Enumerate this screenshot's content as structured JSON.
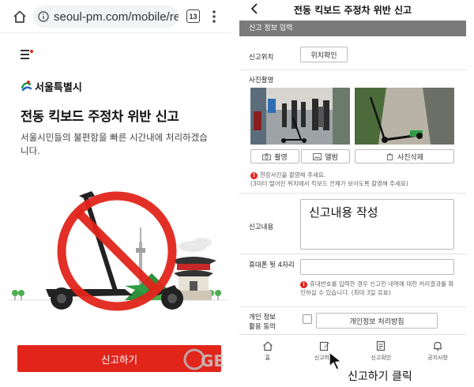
{
  "left": {
    "url": "seoul-pm.com/mobile/report",
    "tab_count": "13",
    "logo_text": "서울특별시",
    "title": "전동 킥보드 주정차 위반 신고",
    "description": "서울시민들의 불편함을 빠른 시간내에 처리하겠습니다.",
    "report_button": "신고하기",
    "watermark": "GE",
    "colors": {
      "accent": "#e1251b"
    }
  },
  "right": {
    "header_title": "전동 킥보드 주정차 위반 신고",
    "section_title": "신고 정보 입력",
    "location_label": "신고위치",
    "location_button": "위치확인",
    "photo_label": "사진촬영",
    "capture_button": "촬영",
    "album_button": "앨범",
    "delete_photo_button": "사진삭제",
    "photo_notice_1": "현장사진을 촬영해 주세요.",
    "photo_notice_2": "(3미터 떨어진 위치에서 킥보드 전체가 보이도록 촬영해 주세요)",
    "content_label": "신고내용",
    "content_overlay": "신고내용 작성",
    "phone_label": "휴대폰 뒷 4자리",
    "phone_notice": "휴대번호를 입력한 경우 신고한 내역에 대한 처리결과를 확인하실 수 있습니다. (최대 3일 유효)",
    "privacy_label_1": "개인 정보",
    "privacy_label_2": "활용 동의",
    "privacy_button": "개인정보 처리방침",
    "nav": [
      {
        "label": "홈",
        "icon": "home-icon"
      },
      {
        "label": "신고하기",
        "icon": "edit-icon"
      },
      {
        "label": "신고확인",
        "icon": "document-icon"
      },
      {
        "label": "공지사항",
        "icon": "bell-icon"
      }
    ]
  },
  "caption": "신고하기 클릭"
}
